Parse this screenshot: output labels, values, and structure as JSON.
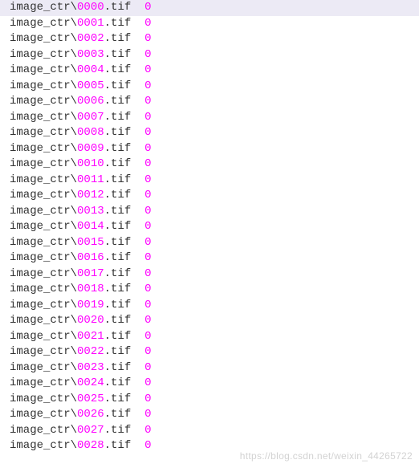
{
  "prefix": "image_ctr",
  "separator": "\\",
  "extension": ".tif",
  "spacer": "  ",
  "lines": [
    {
      "number": "0000",
      "label": "0",
      "selected": true
    },
    {
      "number": "0001",
      "label": "0",
      "selected": false
    },
    {
      "number": "0002",
      "label": "0",
      "selected": false
    },
    {
      "number": "0003",
      "label": "0",
      "selected": false
    },
    {
      "number": "0004",
      "label": "0",
      "selected": false
    },
    {
      "number": "0005",
      "label": "0",
      "selected": false
    },
    {
      "number": "0006",
      "label": "0",
      "selected": false
    },
    {
      "number": "0007",
      "label": "0",
      "selected": false
    },
    {
      "number": "0008",
      "label": "0",
      "selected": false
    },
    {
      "number": "0009",
      "label": "0",
      "selected": false
    },
    {
      "number": "0010",
      "label": "0",
      "selected": false
    },
    {
      "number": "0011",
      "label": "0",
      "selected": false
    },
    {
      "number": "0012",
      "label": "0",
      "selected": false
    },
    {
      "number": "0013",
      "label": "0",
      "selected": false
    },
    {
      "number": "0014",
      "label": "0",
      "selected": false
    },
    {
      "number": "0015",
      "label": "0",
      "selected": false
    },
    {
      "number": "0016",
      "label": "0",
      "selected": false
    },
    {
      "number": "0017",
      "label": "0",
      "selected": false
    },
    {
      "number": "0018",
      "label": "0",
      "selected": false
    },
    {
      "number": "0019",
      "label": "0",
      "selected": false
    },
    {
      "number": "0020",
      "label": "0",
      "selected": false
    },
    {
      "number": "0021",
      "label": "0",
      "selected": false
    },
    {
      "number": "0022",
      "label": "0",
      "selected": false
    },
    {
      "number": "0023",
      "label": "0",
      "selected": false
    },
    {
      "number": "0024",
      "label": "0",
      "selected": false
    },
    {
      "number": "0025",
      "label": "0",
      "selected": false
    },
    {
      "number": "0026",
      "label": "0",
      "selected": false
    },
    {
      "number": "0027",
      "label": "0",
      "selected": false
    },
    {
      "number": "0028",
      "label": "0",
      "selected": false
    }
  ],
  "watermark": "https://blog.csdn.net/weixin_44265722"
}
